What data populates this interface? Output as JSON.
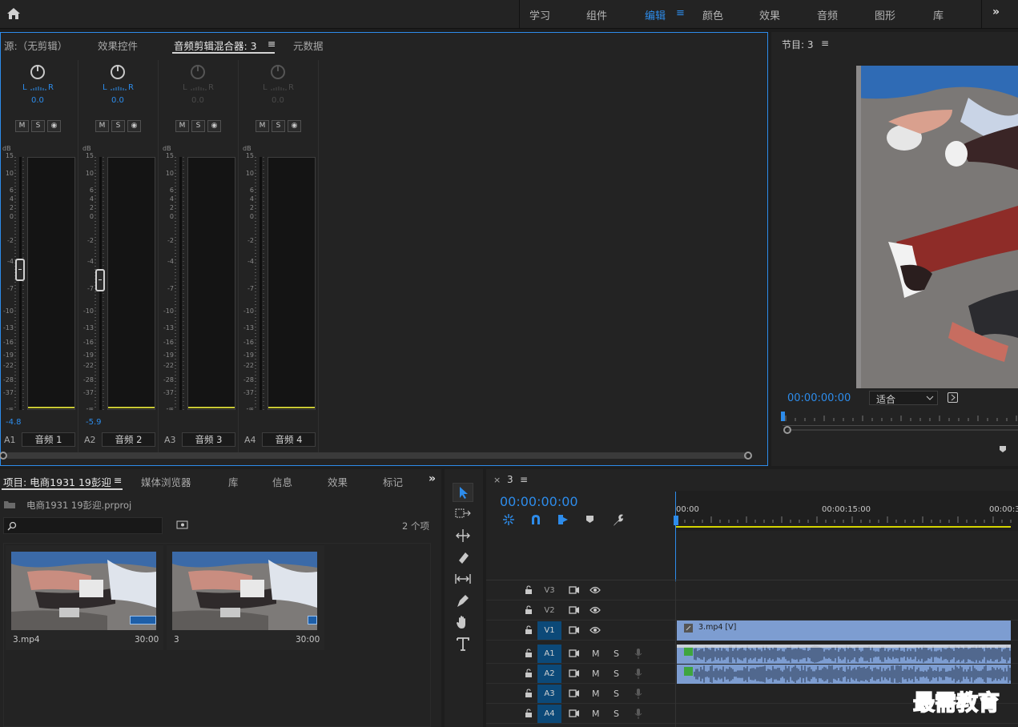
{
  "topbar": {
    "workspaces": [
      "学习",
      "组件",
      "编辑",
      "颜色",
      "效果",
      "音频",
      "图形",
      "库"
    ],
    "active_workspace": "编辑",
    "menu_glyph": "≡",
    "more_glyph": "»"
  },
  "mixer": {
    "tabs": [
      "源:（无剪辑）",
      "效果控件",
      "音频剪辑混合器: 3",
      "元数据"
    ],
    "active_tab_menu": "≡",
    "db_unit": "dB",
    "db_scale": [
      "15",
      "10",
      "6",
      "4",
      "2",
      "0",
      "-2",
      "-4",
      "-7",
      "-10",
      "-13",
      "-16",
      "-19",
      "-22",
      "-28",
      "-37",
      "-∞"
    ],
    "channels": [
      {
        "pan_l": "L",
        "pan_r": "R",
        "pan_value": "0.0",
        "m": "M",
        "s": "S",
        "r": "◉",
        "value": "-4.8",
        "id": "A1",
        "name": "音频 1",
        "active": true,
        "fader_db": -4.8
      },
      {
        "pan_l": "L",
        "pan_r": "R",
        "pan_value": "0.0",
        "m": "M",
        "s": "S",
        "r": "◉",
        "value": "-5.9",
        "id": "A2",
        "name": "音频 2",
        "active": true,
        "fader_db": -5.9
      },
      {
        "pan_l": "L",
        "pan_r": "R",
        "pan_value": "0.0",
        "m": "M",
        "s": "S",
        "r": "◉",
        "value": "",
        "id": "A3",
        "name": "音频 3",
        "active": false
      },
      {
        "pan_l": "L",
        "pan_r": "R",
        "pan_value": "0.0",
        "m": "M",
        "s": "S",
        "r": "◉",
        "value": "",
        "id": "A4",
        "name": "音频 4",
        "active": false
      }
    ]
  },
  "program": {
    "title": "节目: 3",
    "menu": "≡",
    "timecode": "00:00:00:00",
    "fit_label": "适合"
  },
  "project": {
    "tabs": [
      "项目: 电商1931  19彭迎",
      "媒体浏览器",
      "库",
      "信息",
      "效果",
      "标记"
    ],
    "menu": "≡",
    "more": "»",
    "file_name": "电商1931  19彭迎.prproj",
    "search_placeholder": "",
    "item_count": "2 个项",
    "items": [
      {
        "name": "3.mp4",
        "duration": "30:00"
      },
      {
        "name": "3",
        "duration": "30:00"
      }
    ]
  },
  "timeline": {
    "close": "×",
    "sequence": "3",
    "menu": "≡",
    "timecode": "00:00:00:00",
    "ruler": [
      "00:00",
      "00:00:15:00",
      "00:00:3"
    ],
    "tracks": [
      {
        "id": "V3",
        "type": "video",
        "on": false
      },
      {
        "id": "V2",
        "type": "video",
        "on": false
      },
      {
        "id": "V1",
        "type": "video",
        "on": true
      },
      {
        "id": "A1",
        "type": "audio",
        "on": true
      },
      {
        "id": "A2",
        "type": "audio",
        "on": true
      },
      {
        "id": "A3",
        "type": "audio",
        "on": true
      },
      {
        "id": "A4",
        "type": "audio",
        "on": true
      }
    ],
    "mute": "M",
    "solo": "S",
    "video_clip": "3.mp4 [V]"
  },
  "watermark": "最需教育",
  "colors": {
    "accent": "#2d8ceb",
    "clip": "#7d9dd1",
    "track_on": "#0c4978"
  }
}
